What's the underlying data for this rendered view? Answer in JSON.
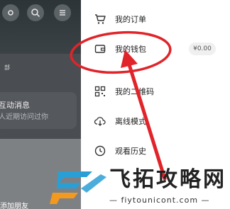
{
  "background": {
    "section_tag": "部",
    "card_title": "互动消息",
    "card_subtitle": "人近期访问过你",
    "bottom_text": "添加朋友"
  },
  "menu": {
    "items": [
      {
        "label": "我的订单",
        "icon": "cart-icon"
      },
      {
        "label": "我的钱包",
        "icon": "wallet-icon",
        "badge": "¥0.00"
      },
      {
        "label": "我的二维码",
        "icon": "qr-code-icon"
      },
      {
        "label": "离线模式",
        "icon": "cloud-download-icon"
      },
      {
        "label": "观看历史",
        "icon": "clock-icon"
      }
    ]
  },
  "watermark": {
    "brand": "飞拓攻略网",
    "url": "— fiytounicont.com —"
  },
  "colors": {
    "annotation": "#e0242a",
    "watermark_blue": "#2a9fd6",
    "watermark_orange": "#f39a1e"
  }
}
